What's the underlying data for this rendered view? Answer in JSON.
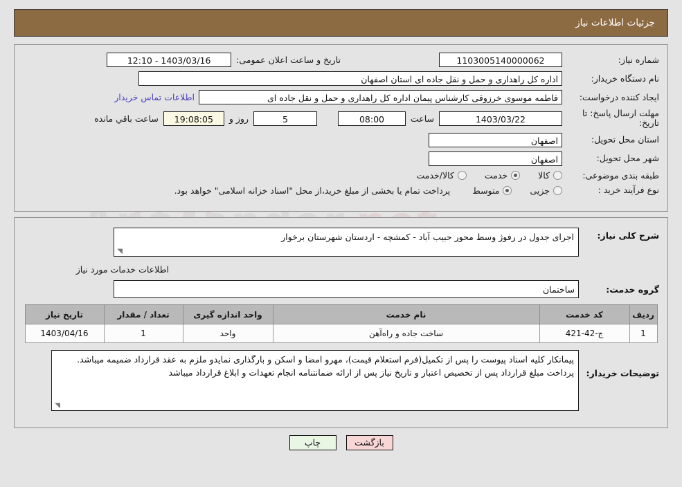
{
  "header": {
    "title": "جزئیات اطلاعات نیاز"
  },
  "colors": {
    "header_bar": "#8c6b43",
    "panel_bg": "#e4e4e4",
    "link": "#4b3fbe",
    "countdown_bg": "#fbf8e3",
    "back_btn": "#f9d6d6",
    "print_btn": "#e8f6e3",
    "table_header": "#b9b9b9"
  },
  "form": {
    "need_number": {
      "label": "شماره نیاز:",
      "value": "1103005140000062"
    },
    "public_announce": {
      "label": "تاریخ و ساعت اعلان عمومی:",
      "value": "1403/03/16 - 12:10"
    },
    "buyer_org": {
      "label": "نام دستگاه خریدار:",
      "value": "اداره کل راهداری و حمل و نقل جاده ای استان اصفهان"
    },
    "requester": {
      "label": "ایجاد کننده درخواست:",
      "value": "فاطمه موسوی خرزوقی کارشناس پیمان اداره کل راهداری و حمل و نقل جاده ای",
      "contact_link": "اطلاعات تماس خریدار"
    },
    "deadline": {
      "label": "مهلت ارسال پاسخ: تا تاریخ:",
      "date": "1403/03/22",
      "hour_label": "ساعت",
      "hour": "08:00",
      "days": "5",
      "days_suffix": "روز و",
      "countdown": "19:08:05",
      "countdown_suffix": "ساعت باقي مانده"
    },
    "province": {
      "label": "استان محل تحویل:",
      "value": "اصفهان"
    },
    "city": {
      "label": "شهر محل تحویل:",
      "value": "اصفهان"
    },
    "category": {
      "label": "طبقه بندی موضوعی:",
      "options": [
        {
          "label": "کالا",
          "selected": false
        },
        {
          "label": "خدمت",
          "selected": true
        },
        {
          "label": "کالا/خدمت",
          "selected": false
        }
      ]
    },
    "process_type": {
      "label": "نوع فرآیند خرید :",
      "options": [
        {
          "label": "جزیی",
          "selected": false
        },
        {
          "label": "متوسط",
          "selected": true
        }
      ],
      "note": "پرداخت تمام یا بخشی از مبلغ خرید،از محل \"اسناد خزانه اسلامی\" خواهد بود."
    }
  },
  "description": {
    "label": "شرح کلی نیاز:",
    "value": "اجرای جدول در رفوژ وسط محور حبیب آباد - کمشچه - اردستان شهرستان برخوار"
  },
  "services_section": {
    "title": "اطلاعات خدمات مورد نیاز",
    "service_group": {
      "label": "گروه خدمت:",
      "value": "ساختمان"
    },
    "table": {
      "columns": [
        "ردیف",
        "کد خدمت",
        "نام خدمت",
        "واحد اندازه گیری",
        "تعداد / مقدار",
        "تاریخ نیاز"
      ],
      "rows": [
        {
          "row_no": "1",
          "service_code": "ج-42-421",
          "service_name": "ساخت جاده و راه‌آهن",
          "unit": "واحد",
          "quantity": "1",
          "need_date": "1403/04/16"
        }
      ]
    }
  },
  "buyer_notes": {
    "label": "توضیحات خریدار:",
    "value": "پیمانکار کلیه اسناد پیوست را پس از تکمیل(فرم استعلام قیمت)، مهرو امضا و اسکن و بارگذاری نمایدو ملزم به عقد قرارداد ضمیمه میباشد. پرداخت مبلغ قرارداد پس از تخصیص اعتبار و تاریخ نیاز پس از ارائه ضمانتنامه انجام تعهدات و ابلاغ قرارداد میباشد"
  },
  "footer": {
    "back_label": "بازگشت",
    "print_label": "چاپ"
  },
  "watermark": {
    "text_left": "Ana",
    "text_mid": "Tender",
    "text_right": ".net"
  }
}
